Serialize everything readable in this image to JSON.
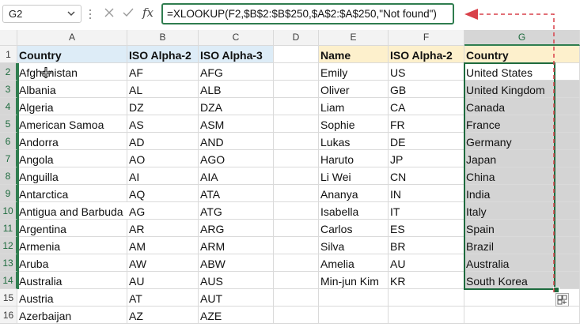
{
  "name_box": {
    "value": "G2"
  },
  "formula_bar": {
    "formula": "=XLOOKUP(F2,$B$2:$B$250,$A$2:$A$250,\"Not found\")",
    "cancel_icon": "x-icon",
    "enter_icon": "check-icon",
    "function_icon_label": "fx",
    "annotation_color": "#d9414a"
  },
  "columns": [
    "A",
    "B",
    "C",
    "D",
    "E",
    "F",
    "G"
  ],
  "rows": [
    "1",
    "2",
    "3",
    "4",
    "5",
    "6",
    "7",
    "8",
    "9",
    "10",
    "11",
    "12",
    "13",
    "14",
    "15",
    "16"
  ],
  "table1": {
    "headers": [
      "Country",
      "ISO Alpha-2",
      "ISO Alpha-3"
    ],
    "rows": [
      [
        "Afghanistan",
        "AF",
        "AFG"
      ],
      [
        "Albania",
        "AL",
        "ALB"
      ],
      [
        "Algeria",
        "DZ",
        "DZA"
      ],
      [
        "American Samoa",
        "AS",
        "ASM"
      ],
      [
        "Andorra",
        "AD",
        "AND"
      ],
      [
        "Angola",
        "AO",
        "AGO"
      ],
      [
        "Anguilla",
        "AI",
        "AIA"
      ],
      [
        "Antarctica",
        "AQ",
        "ATA"
      ],
      [
        "Antigua and Barbuda",
        "AG",
        "ATG"
      ],
      [
        "Argentina",
        "AR",
        "ARG"
      ],
      [
        "Armenia",
        "AM",
        "ARM"
      ],
      [
        "Aruba",
        "AW",
        "ABW"
      ],
      [
        "Australia",
        "AU",
        "AUS"
      ],
      [
        "Austria",
        "AT",
        "AUT"
      ],
      [
        "Azerbaijan",
        "AZ",
        "AZE"
      ]
    ]
  },
  "table2": {
    "headers": [
      "Name",
      "ISO Alpha-2",
      "Country"
    ],
    "rows": [
      [
        "Emily",
        "US",
        "United States"
      ],
      [
        "Oliver",
        "GB",
        "United Kingdom"
      ],
      [
        "Liam",
        "CA",
        "Canada"
      ],
      [
        "Sophie",
        "FR",
        "France"
      ],
      [
        "Lukas",
        "DE",
        "Germany"
      ],
      [
        "Haruto",
        "JP",
        "Japan"
      ],
      [
        "Li Wei",
        "CN",
        "China"
      ],
      [
        "Ananya",
        "IN",
        "India"
      ],
      [
        "Isabella",
        "IT",
        "Italy"
      ],
      [
        "Carlos",
        "ES",
        "Spain"
      ],
      [
        "Silva",
        "BR",
        "Brazil"
      ],
      [
        "Amelia",
        "AU",
        "Australia"
      ],
      [
        "Min-jun Kim",
        "KR",
        "South Korea"
      ]
    ]
  },
  "colors": {
    "header_blue": "#ddecf7",
    "header_yellow": "#fdf0cc",
    "selection_green": "#1e6b3e",
    "selected_range_gray": "#d4d4d4"
  }
}
